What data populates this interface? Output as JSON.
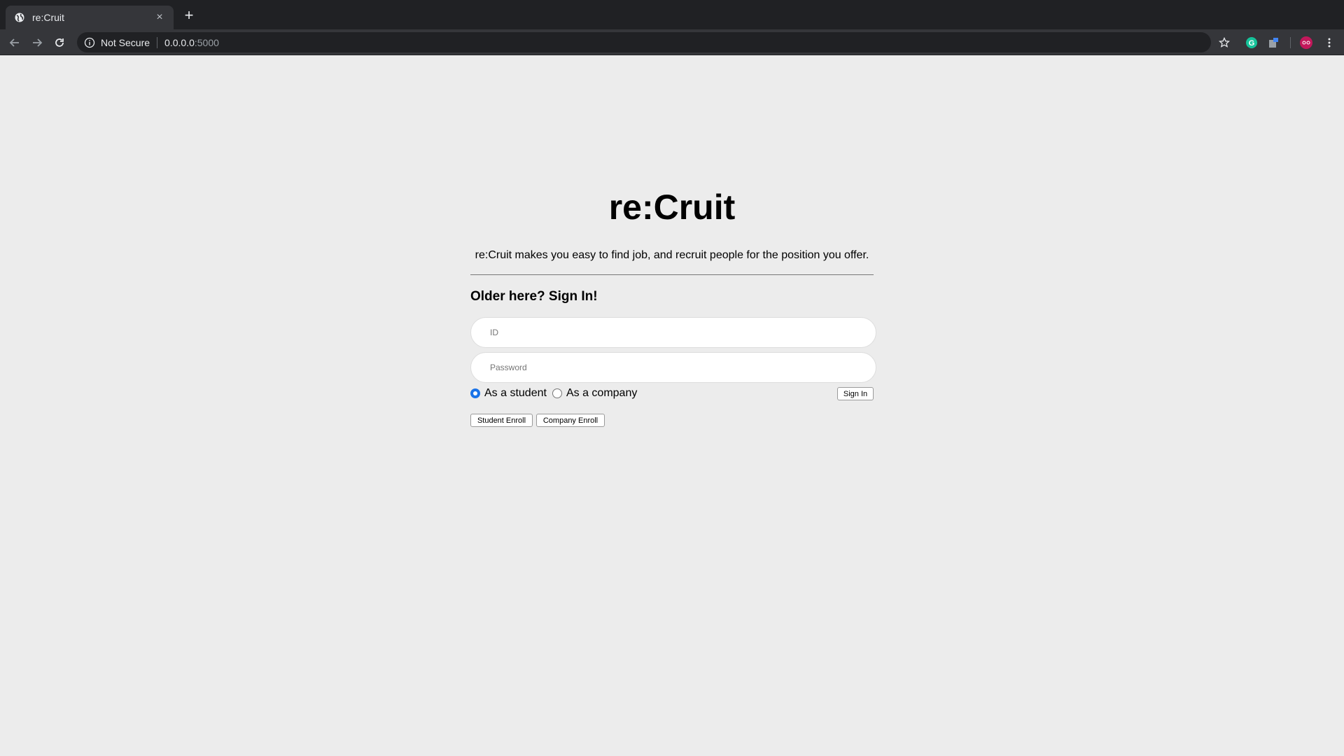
{
  "browser": {
    "tab_title": "re:Cruit",
    "security_label": "Not Secure",
    "url_host": "0.0.0.0",
    "url_port": ":5000"
  },
  "page": {
    "title": "re:Cruit",
    "tagline": "re:Cruit makes you easy to find job, and recruit people for the position you offer.",
    "signin_heading": "Older here? Sign In!",
    "id_placeholder": "ID",
    "password_placeholder": "Password",
    "radio_student": "As a student",
    "radio_company": "As a company",
    "selected_role": "student",
    "signin_button": "Sign In",
    "student_enroll_button": "Student Enroll",
    "company_enroll_button": "Company Enroll"
  },
  "colors": {
    "page_background": "#ececec",
    "accent": "#1a73e8"
  }
}
